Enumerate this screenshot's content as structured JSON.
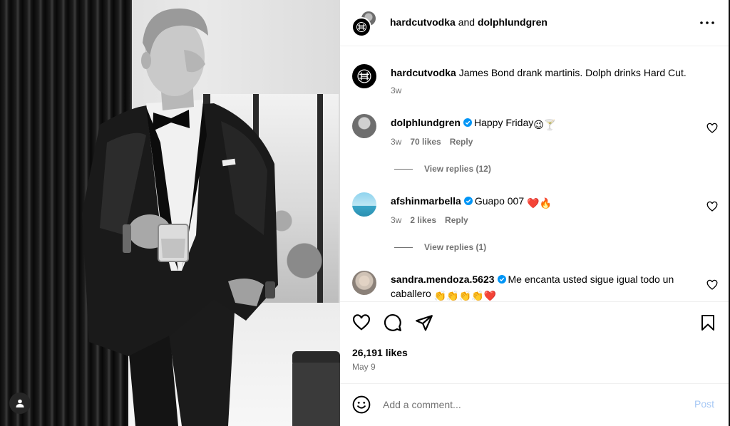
{
  "header": {
    "account_1": "hardcutvodka",
    "connector": "and",
    "account_2": "dolphlundgren"
  },
  "caption": {
    "username": "hardcutvodka",
    "text": "James Bond drank martinis. Dolph drinks Hard Cut.",
    "time": "3w"
  },
  "comments": [
    {
      "username": "dolphlundgren",
      "verified": true,
      "text": "Happy Friday",
      "emojis": [
        "😉",
        "🍸"
      ],
      "time": "3w",
      "likes": "70 likes",
      "reply": "Reply",
      "view_replies": "View replies (12)"
    },
    {
      "username": "afshinmarbella",
      "verified": true,
      "text": "Guapo 007",
      "emojis": [
        "❤️",
        "🔥"
      ],
      "time": "3w",
      "likes": "2 likes",
      "reply": "Reply",
      "view_replies": "View replies (1)"
    },
    {
      "username": "sandra.mendoza.5623",
      "verified": true,
      "text": "Me encanta usted sigue igual todo un caballero",
      "emojis": [
        "👏",
        "👏",
        "👏",
        "👏",
        "❤️"
      ]
    }
  ],
  "post": {
    "likes": "26,191 likes",
    "date": "May 9"
  },
  "add_comment": {
    "placeholder": "Add a comment...",
    "post_label": "Post"
  },
  "colors": {
    "verified": "#0095f6",
    "muted": "#737373",
    "post_disabled": "#a6c8f5",
    "heart_red": "#e0245e"
  }
}
